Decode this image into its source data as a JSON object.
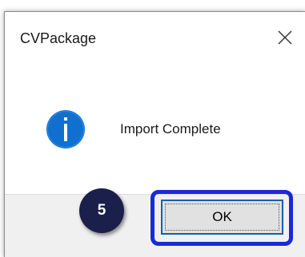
{
  "dialog": {
    "title": "CVPackage",
    "message": "Import Complete",
    "ok_label": "OK"
  },
  "icons": {
    "close": "close-icon",
    "info": "info-icon"
  },
  "step_badge": {
    "number": "5"
  },
  "colors": {
    "info_icon": "#1170cf",
    "highlight_border": "#1a2ad6",
    "step_badge_bg": "#1b1f4b",
    "ok_button_border": "#0063b1"
  }
}
